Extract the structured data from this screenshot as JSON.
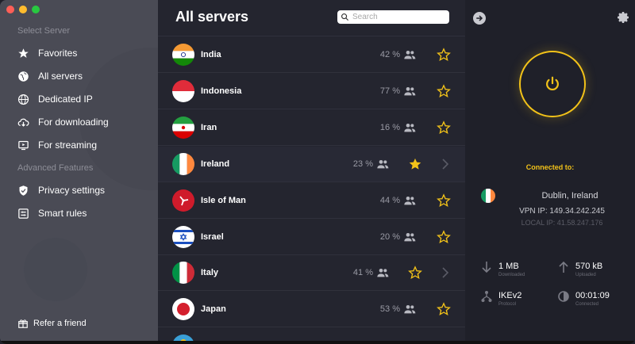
{
  "sidebar": {
    "section_servers": "Select Server",
    "items": [
      {
        "label": "Favorites",
        "icon": "star-icon"
      },
      {
        "label": "All servers",
        "icon": "globe-icon"
      },
      {
        "label": "Dedicated IP",
        "icon": "dedicated-ip-icon"
      },
      {
        "label": "For downloading",
        "icon": "cloud-download-icon"
      },
      {
        "label": "For streaming",
        "icon": "streaming-icon"
      }
    ],
    "section_advanced": "Advanced Features",
    "advanced_items": [
      {
        "label": "Privacy settings",
        "icon": "shield-icon"
      },
      {
        "label": "Smart rules",
        "icon": "rules-icon"
      }
    ],
    "refer": "Refer a friend"
  },
  "list": {
    "title": "All servers",
    "search_placeholder": "Search",
    "rows": [
      {
        "name": "India",
        "load": "42 %",
        "favorite": false
      },
      {
        "name": "Indonesia",
        "load": "77 %",
        "favorite": false
      },
      {
        "name": "Iran",
        "load": "16 %",
        "favorite": false
      },
      {
        "name": "Ireland",
        "load": "23 %",
        "favorite": true
      },
      {
        "name": "Isle of Man",
        "load": "44 %",
        "favorite": false
      },
      {
        "name": "Israel",
        "load": "20 %",
        "favorite": false
      },
      {
        "name": "Italy",
        "load": "41 %",
        "favorite": false
      },
      {
        "name": "Japan",
        "load": "53 %",
        "favorite": false
      }
    ]
  },
  "status": {
    "connected_to": "Connected to:",
    "location": "Dublin, Ireland",
    "vpn_ip": "VPN IP: 149.34.242.245",
    "local_ip": "LOCAL IP: 41.58.247.176",
    "downloaded_value": "1 MB",
    "downloaded_label": "Downloaded",
    "uploaded_value": "570 kB",
    "uploaded_label": "Uploaded",
    "protocol_value": "IKEv2",
    "protocol_label": "Protocol",
    "time_value": "00:01:09",
    "time_label": "Connected"
  },
  "colors": {
    "accent": "#f2c219",
    "sidebar_bg": "#4a4b55",
    "list_bg": "#24252f",
    "panel_bg": "#1f2029"
  }
}
